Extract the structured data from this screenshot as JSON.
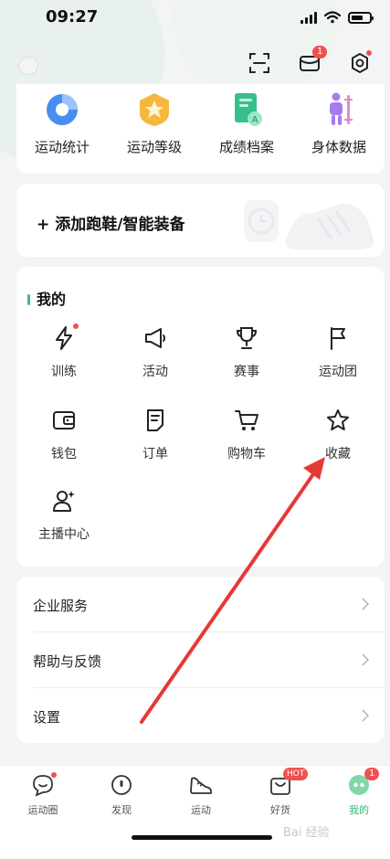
{
  "status": {
    "time": "09:27"
  },
  "top": {
    "message_badge": "1"
  },
  "quick": [
    {
      "label": "运动统计",
      "icon": "pie-chart-icon"
    },
    {
      "label": "运动等级",
      "icon": "medal-icon"
    },
    {
      "label": "成绩档案",
      "icon": "certificate-icon"
    },
    {
      "label": "身体数据",
      "icon": "body-data-icon"
    }
  ],
  "add_gear": {
    "label": "添加跑鞋/智能装备"
  },
  "mine": {
    "title": "我的",
    "items": [
      {
        "label": "训练",
        "icon": "lightning-icon"
      },
      {
        "label": "活动",
        "icon": "megaphone-icon"
      },
      {
        "label": "赛事",
        "icon": "trophy-icon"
      },
      {
        "label": "运动团",
        "icon": "flag-icon"
      },
      {
        "label": "钱包",
        "icon": "wallet-icon"
      },
      {
        "label": "订单",
        "icon": "order-icon"
      },
      {
        "label": "购物车",
        "icon": "cart-icon"
      },
      {
        "label": "收藏",
        "icon": "star-icon"
      },
      {
        "label": "主播中心",
        "icon": "anchor-icon"
      }
    ]
  },
  "list": [
    {
      "label": "企业服务"
    },
    {
      "label": "帮助与反馈"
    },
    {
      "label": "设置"
    }
  ],
  "tabs": [
    {
      "label": "运动圈",
      "icon": "chat-bubble-icon"
    },
    {
      "label": "发现",
      "icon": "compass-icon"
    },
    {
      "label": "运动",
      "icon": "shoe-icon"
    },
    {
      "label": "好货",
      "icon": "shop-bag-icon",
      "badge": "HOT"
    },
    {
      "label": "我的",
      "icon": "profile-icon",
      "badge": "1"
    }
  ],
  "watermark": "Bai 经验",
  "colors": {
    "accent": "#2fb872",
    "badge": "#f05050",
    "annotation": "#e53935"
  }
}
